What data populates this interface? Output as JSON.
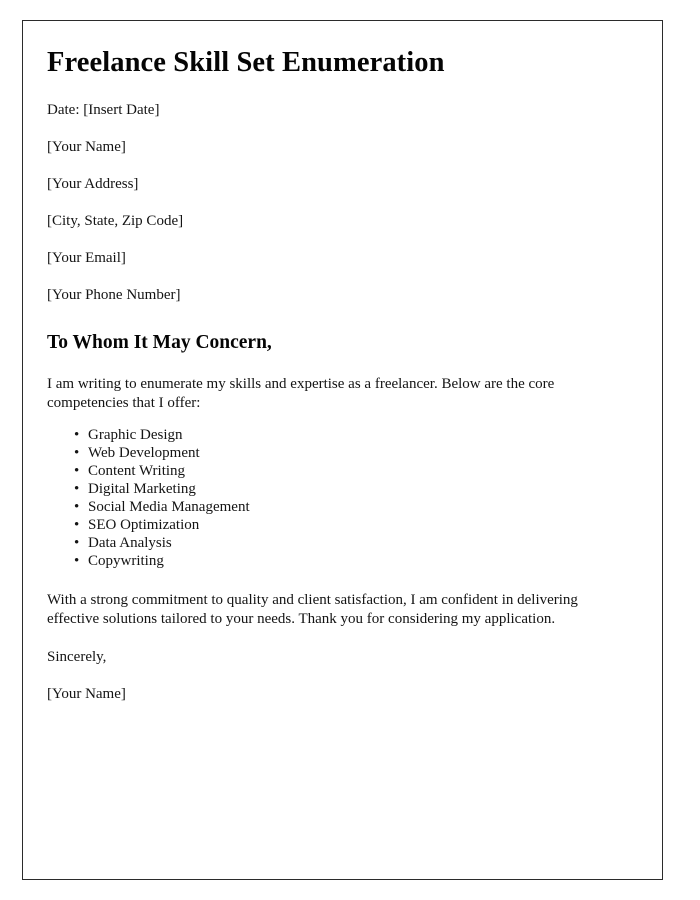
{
  "document": {
    "title": "Freelance Skill Set Enumeration",
    "border_color": "#2b2b2b",
    "text_color": "#141414",
    "background_color": "#ffffff",
    "meta": [
      {
        "label": "Date: [Insert Date]"
      },
      {
        "label": "[Your Name]"
      },
      {
        "label": "[Your Address]"
      },
      {
        "label": "[City, State, Zip Code]"
      },
      {
        "label": "[Your Email]"
      },
      {
        "label": "[Your Phone Number]"
      }
    ],
    "salutation": "To Whom It May Concern,",
    "intro_paragraph": "I am writing to enumerate my skills and expertise as a freelancer. Below are the core competencies that I offer:",
    "bullet_glyph": "•",
    "skills": [
      "Graphic Design",
      "Web Development",
      "Content Writing",
      "Digital Marketing",
      "Social Media Management",
      "SEO Optimization",
      "Data Analysis",
      "Copywriting"
    ],
    "closing_paragraph": "With a strong commitment to quality and client satisfaction, I am confident in delivering effective solutions tailored to your needs. Thank you for considering my application.",
    "signoff": [
      {
        "label": "Sincerely,"
      },
      {
        "label": "[Your Name]"
      }
    ]
  }
}
